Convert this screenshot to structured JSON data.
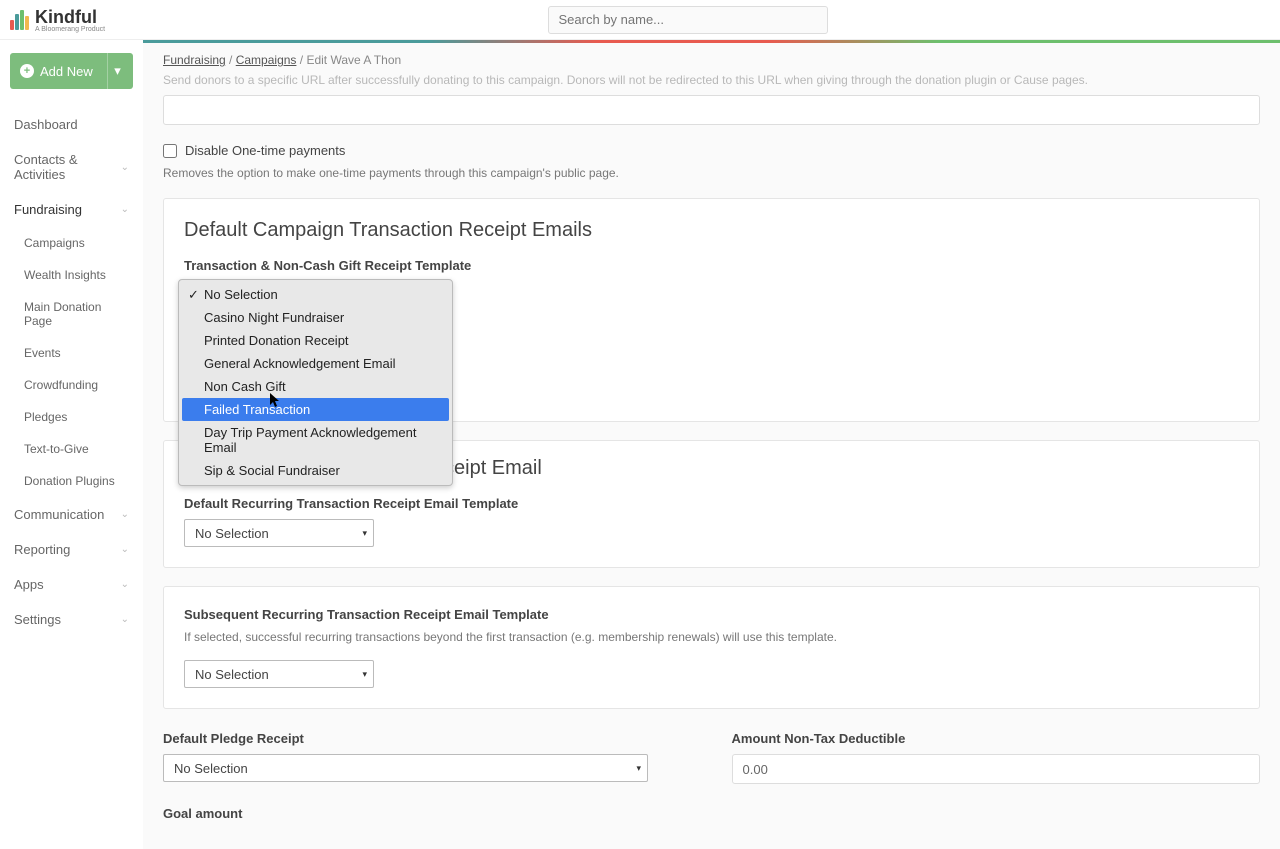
{
  "logo": {
    "name": "Kindful",
    "tagline": "A Bloomerang Product"
  },
  "search": {
    "placeholder": "Search by name..."
  },
  "sidebar": {
    "addNew": "Add New",
    "items": {
      "dashboard": "Dashboard",
      "contacts": "Contacts & Activities",
      "fundraising": "Fundraising",
      "communication": "Communication",
      "reporting": "Reporting",
      "apps": "Apps",
      "settings": "Settings"
    },
    "fundraisingSub": [
      "Campaigns",
      "Wealth Insights",
      "Main Donation Page",
      "Events",
      "Crowdfunding",
      "Pledges",
      "Text-to-Give",
      "Donation Plugins"
    ]
  },
  "breadcrumb": {
    "a": "Fundraising",
    "b": "Campaigns",
    "c": "Edit Wave A Thon"
  },
  "form": {
    "redirectHelp": "Send donors to a specific URL after successfully donating to this campaign. Donors will not be redirected to this URL when giving through the donation plugin or Cause pages.",
    "disableOneTime": "Disable One-time payments",
    "disableOneTimeHelp": "Removes the option to make one-time payments through this campaign's public page.",
    "card1Title": "Default Campaign Transaction Receipt Emails",
    "card1Label": "Transaction & Non-Cash Gift Receipt Template",
    "dropdownOptions": [
      "No Selection",
      "Casino Night Fundraiser",
      "Printed Donation Receipt",
      "General Acknowledgement Email",
      "Non Cash Gift",
      "Failed Transaction",
      "Day Trip Payment Acknowledgement Email",
      "Sip & Social Fundraiser"
    ],
    "card2TitlePartial": "ceipt Email",
    "card2Label": "Default Recurring Transaction Receipt Email Template",
    "noSelection": "No Selection",
    "card3Label": "Subsequent Recurring Transaction Receipt Email Template",
    "card3Help": "If selected, successful recurring transactions beyond the first transaction (e.g. membership renewals) will use this template.",
    "pledgeLabel": "Default Pledge Receipt",
    "amountLabel": "Amount Non-Tax Deductible",
    "amountValue": "0.00",
    "goalLabel": "Goal amount"
  }
}
